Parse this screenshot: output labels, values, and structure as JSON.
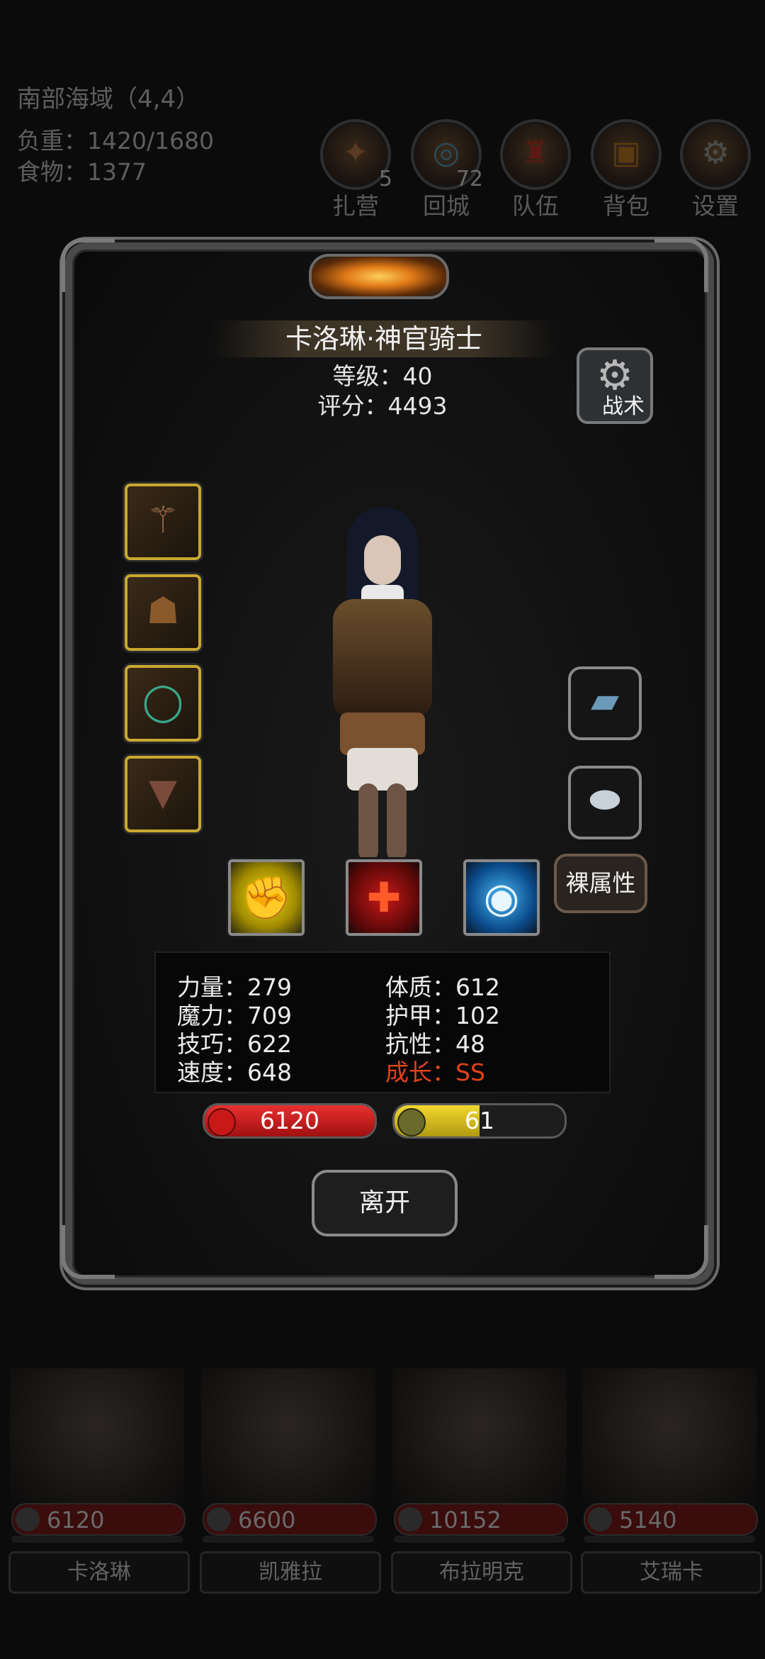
{
  "hud": {
    "location": "南部海域（4,4）",
    "load": "负重：1420/1680",
    "food": "食物：1377"
  },
  "top_buttons": [
    {
      "label": "扎营",
      "badge": "5",
      "icon": "campfire-icon"
    },
    {
      "label": "回城",
      "badge": "72",
      "icon": "portal-icon"
    },
    {
      "label": "队伍",
      "badge": "",
      "icon": "team-icon"
    },
    {
      "label": "背包",
      "badge": "",
      "icon": "backpack-icon"
    },
    {
      "label": "设置",
      "badge": "",
      "icon": "gear-icon"
    }
  ],
  "hero": {
    "name": "卡洛琳·神官骑士",
    "level": "等级：40",
    "score": "评分：4493",
    "tactics_label": "战术",
    "naked_label": "裸属性",
    "leave_label": "离开",
    "hp": "6120",
    "energy": "61",
    "energy_fraction": 0.5
  },
  "equipment_left": [
    "mace-icon",
    "cloak-icon",
    "ring-icon",
    "cape-icon"
  ],
  "equipment_right": [
    "book-icon",
    "stone-icon"
  ],
  "skills": [
    "fist-icon",
    "heal-cross-icon",
    "eye-icon"
  ],
  "stats": {
    "str": "力量：279",
    "mag": "魔力：709",
    "skill": "技巧：622",
    "speed": "速度：648",
    "con": "体质：612",
    "armor": "护甲：102",
    "resist": "抗性：48",
    "growth": "成长：SS"
  },
  "team": [
    {
      "name": "卡洛琳",
      "hp": "6120"
    },
    {
      "name": "凯雅拉",
      "hp": "6600"
    },
    {
      "name": "布拉明克",
      "hp": "10152"
    },
    {
      "name": "艾瑞卡",
      "hp": "5140"
    }
  ],
  "colors": {
    "accent_gold": "#c8a830",
    "hp_red": "#c81818",
    "energy_yellow": "#e0c020",
    "growth_red": "#e0421a"
  }
}
